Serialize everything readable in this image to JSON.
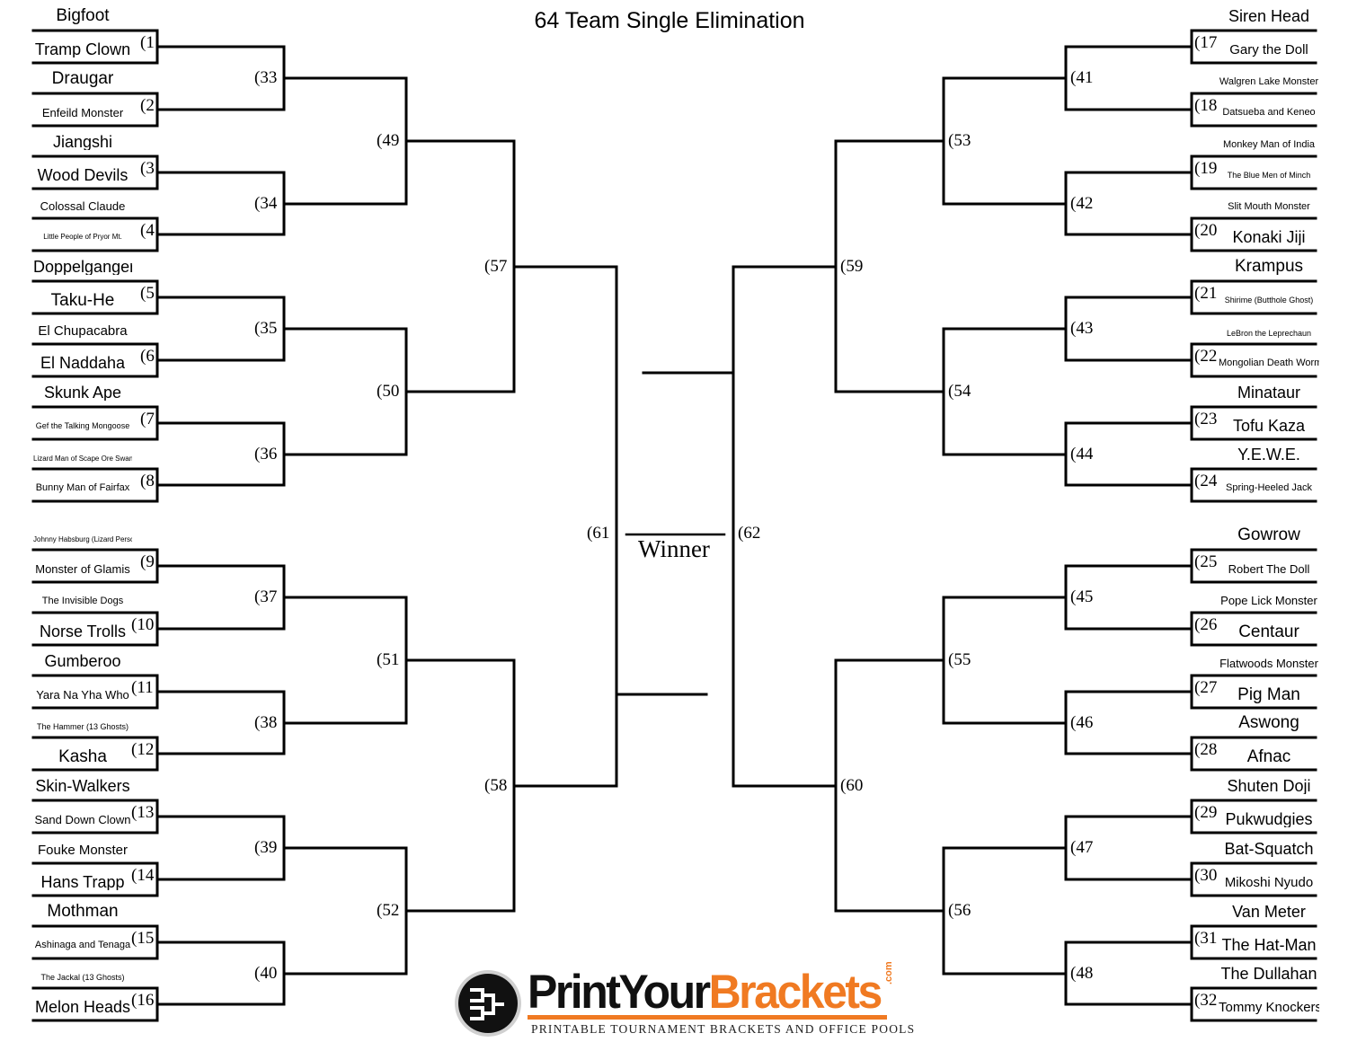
{
  "title": "64 Team Single Elimination",
  "winner_label": "Winner",
  "left": {
    "slots": [
      {
        "seed": "(1",
        "top": "Bigfoot",
        "bottom": "Tramp Clown"
      },
      {
        "seed": "(2",
        "top": "Draugar",
        "bottom": "Enfeild Monster"
      },
      {
        "seed": "(3",
        "top": "Jiangshi",
        "bottom": "Wood Devils"
      },
      {
        "seed": "(4",
        "top": "Colossal Claude",
        "bottom": "Little People of Pryor Mt."
      },
      {
        "seed": "(5",
        "top": "Doppelganger",
        "bottom": "Taku-He"
      },
      {
        "seed": "(6",
        "top": "El Chupacabra",
        "bottom": "El Naddaha"
      },
      {
        "seed": "(7",
        "top": "Skunk Ape",
        "bottom": "Gef the Talking Mongoose"
      },
      {
        "seed": "(8",
        "top": "Lizard Man of Scape Ore Swamp",
        "bottom": "Bunny Man of Fairfax"
      },
      {
        "seed": "(9",
        "top": "Johnny Habsburg (Lizard Person)",
        "bottom": "Monster of Glamis"
      },
      {
        "seed": "(10",
        "top": "The Invisible Dogs",
        "bottom": "Norse Trolls"
      },
      {
        "seed": "(11",
        "top": "Gumberoo",
        "bottom": "Yara Na Yha Who"
      },
      {
        "seed": "(12",
        "top": "The Hammer (13 Ghosts)",
        "bottom": "Kasha"
      },
      {
        "seed": "(13",
        "top": "Skin-Walkers",
        "bottom": "Sand Down Clown"
      },
      {
        "seed": "(14",
        "top": "Fouke Monster",
        "bottom": "Hans Trapp"
      },
      {
        "seed": "(15",
        "top": "Mothman",
        "bottom": "Ashinaga and Tenaga"
      },
      {
        "seed": "(16",
        "top": "The Jackal (13 Ghosts)",
        "bottom": "Melon Heads"
      }
    ],
    "round2": [
      "(33",
      "(34",
      "(35",
      "(36",
      "(37",
      "(38",
      "(39",
      "(40"
    ],
    "round3": [
      "(49",
      "(50",
      "(51",
      "(52"
    ],
    "round4": [
      "(57",
      "(58"
    ],
    "semi": "(61"
  },
  "right": {
    "slots": [
      {
        "seed": "(17",
        "top": "Siren Head",
        "bottom": "Gary the Doll"
      },
      {
        "seed": "(18",
        "top": "Walgren Lake Monster",
        "bottom": "Datsueba and Keneo"
      },
      {
        "seed": "(19",
        "top": "Monkey Man of India",
        "bottom": "The Blue Men of Minch"
      },
      {
        "seed": "(20",
        "top": "Slit Mouth Monster",
        "bottom": "Konaki Jiji"
      },
      {
        "seed": "(21",
        "top": "Krampus",
        "bottom": "Shirime (Butthole Ghost)"
      },
      {
        "seed": "(22",
        "top": "LeBron the Leprechaun",
        "bottom": "Mongolian Death Worm"
      },
      {
        "seed": "(23",
        "top": "Minataur",
        "bottom": "Tofu Kaza"
      },
      {
        "seed": "(24",
        "top": "Y.E.W.E.",
        "bottom": "Spring-Heeled Jack"
      },
      {
        "seed": "(25",
        "top": "Gowrow",
        "bottom": "Robert The Doll"
      },
      {
        "seed": "(26",
        "top": "Pope Lick Monster",
        "bottom": "Centaur"
      },
      {
        "seed": "(27",
        "top": "Flatwoods Monster",
        "bottom": "Pig Man"
      },
      {
        "seed": "(28",
        "top": "Aswong",
        "bottom": "Afnac"
      },
      {
        "seed": "(29",
        "top": "Shuten Doji",
        "bottom": "Pukwudgies"
      },
      {
        "seed": "(30",
        "top": "Bat-Squatch",
        "bottom": "Mikoshi Nyudo"
      },
      {
        "seed": "(31",
        "top": "Van Meter",
        "bottom": "The Hat-Man"
      },
      {
        "seed": "(32",
        "top": "The Dullahan",
        "bottom": "Tommy Knockers"
      }
    ],
    "round2": [
      "(41",
      "(42",
      "(43",
      "(44",
      "(45",
      "(46",
      "(47",
      "(48"
    ],
    "round3": [
      "(53",
      "(54",
      "(55",
      "(56"
    ],
    "round4": [
      "(59",
      "(60"
    ],
    "semi": "(62"
  },
  "logo": {
    "brand_part1": "PrintYour",
    "brand_part2": "Brackets",
    "domain_suffix": ".com",
    "tagline": "PRINTABLE TOURNAMENT BRACKETS AND OFFICE POOLS",
    "colors": {
      "dark": "#111111",
      "accent": "#f07a22"
    }
  }
}
